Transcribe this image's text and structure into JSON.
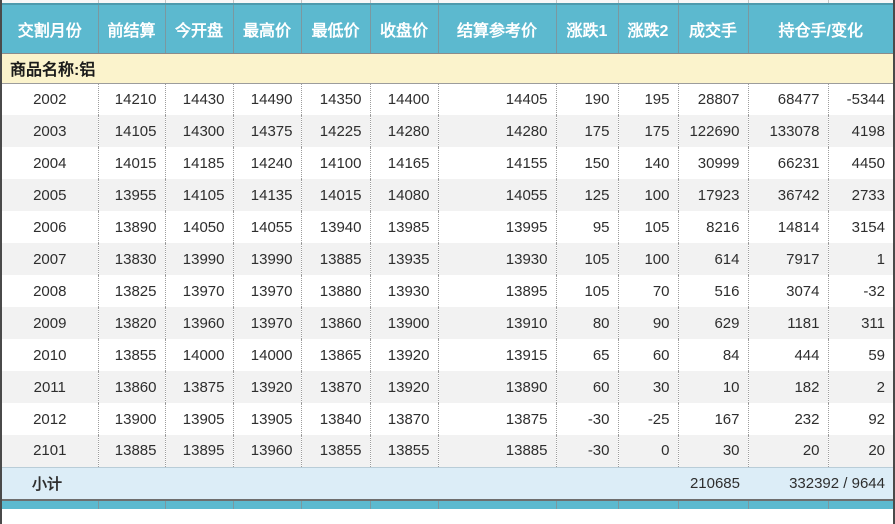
{
  "table": {
    "columns": [
      {
        "label": "交割月份"
      },
      {
        "label": "前结算"
      },
      {
        "label": "今开盘"
      },
      {
        "label": "最高价"
      },
      {
        "label": "最低价"
      },
      {
        "label": "收盘价"
      },
      {
        "label": "结算参考价"
      },
      {
        "label": "涨跌1"
      },
      {
        "label": "涨跌2"
      },
      {
        "label": "成交手"
      },
      {
        "label": "持仓手/变化"
      }
    ],
    "section_label": "商品名称:铝",
    "rows": [
      [
        "2002",
        "14210",
        "14430",
        "14490",
        "14350",
        "14400",
        "14405",
        "190",
        "195",
        "28807",
        "68477",
        "-5344"
      ],
      [
        "2003",
        "14105",
        "14300",
        "14375",
        "14225",
        "14280",
        "14280",
        "175",
        "175",
        "122690",
        "133078",
        "4198"
      ],
      [
        "2004",
        "14015",
        "14185",
        "14240",
        "14100",
        "14165",
        "14155",
        "150",
        "140",
        "30999",
        "66231",
        "4450"
      ],
      [
        "2005",
        "13955",
        "14105",
        "14135",
        "14015",
        "14080",
        "14055",
        "125",
        "100",
        "17923",
        "36742",
        "2733"
      ],
      [
        "2006",
        "13890",
        "14050",
        "14055",
        "13940",
        "13985",
        "13995",
        "95",
        "105",
        "8216",
        "14814",
        "3154"
      ],
      [
        "2007",
        "13830",
        "13990",
        "13990",
        "13885",
        "13935",
        "13930",
        "105",
        "100",
        "614",
        "7917",
        "1"
      ],
      [
        "2008",
        "13825",
        "13970",
        "13970",
        "13880",
        "13930",
        "13895",
        "105",
        "70",
        "516",
        "3074",
        "-32"
      ],
      [
        "2009",
        "13820",
        "13960",
        "13970",
        "13860",
        "13900",
        "13910",
        "80",
        "90",
        "629",
        "1181",
        "311"
      ],
      [
        "2010",
        "13855",
        "14000",
        "14000",
        "13865",
        "13920",
        "13915",
        "65",
        "60",
        "84",
        "444",
        "59"
      ],
      [
        "2011",
        "13860",
        "13875",
        "13920",
        "13870",
        "13920",
        "13890",
        "60",
        "30",
        "10",
        "182",
        "2"
      ],
      [
        "2012",
        "13900",
        "13905",
        "13905",
        "13840",
        "13870",
        "13875",
        "-30",
        "-25",
        "167",
        "232",
        "92"
      ],
      [
        "2101",
        "13885",
        "13895",
        "13960",
        "13855",
        "13855",
        "13885",
        "-30",
        "0",
        "30",
        "20",
        "20"
      ]
    ],
    "subtotal": {
      "label": "小计",
      "volume": "210685",
      "open_interest_change": "332392 / 9644"
    },
    "colors": {
      "header_bg": "#5cb9cf",
      "header_text": "#ffffff",
      "section_bg": "#fbf3cc",
      "row_bg": "#ffffff",
      "row_alt_bg": "#f2f2f2",
      "subtotal_bg": "#dcedf7",
      "data_text": "#2e2e2e"
    }
  }
}
